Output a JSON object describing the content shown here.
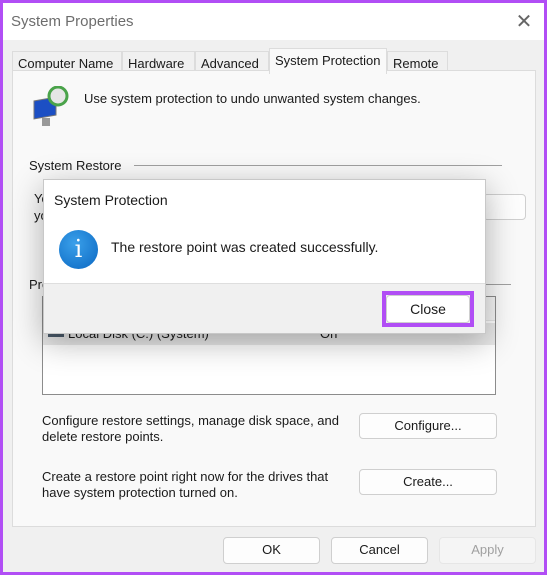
{
  "window": {
    "title": "System Properties",
    "close_icon": "close-icon"
  },
  "tabs": [
    {
      "label": "Computer Name"
    },
    {
      "label": "Hardware"
    },
    {
      "label": "Advanced"
    },
    {
      "label": "System Protection",
      "active": true
    },
    {
      "label": "Remote"
    }
  ],
  "panel": {
    "intro": "Use system protection to undo unwanted system changes.",
    "system_restore_heading": "System Restore",
    "restore_text_line1": "Yo",
    "restore_text_line2": "yo",
    "protection_heading": "Pro",
    "drive_name": "Local Disk (C:) (System)",
    "drive_status": "On",
    "configure_text": "Configure restore settings, manage disk space, and delete restore points.",
    "configure_button": "Configure...",
    "create_text": "Create a restore point right now for the drives that have system protection turned on.",
    "create_button": "Create..."
  },
  "footer": {
    "ok": "OK",
    "cancel": "Cancel",
    "apply": "Apply"
  },
  "dialog": {
    "title": "System Protection",
    "message": "The restore point was created successfully.",
    "icon": "info-icon",
    "close": "Close"
  },
  "colors": {
    "highlight": "#b14ef5",
    "info": "#0a67c2"
  }
}
